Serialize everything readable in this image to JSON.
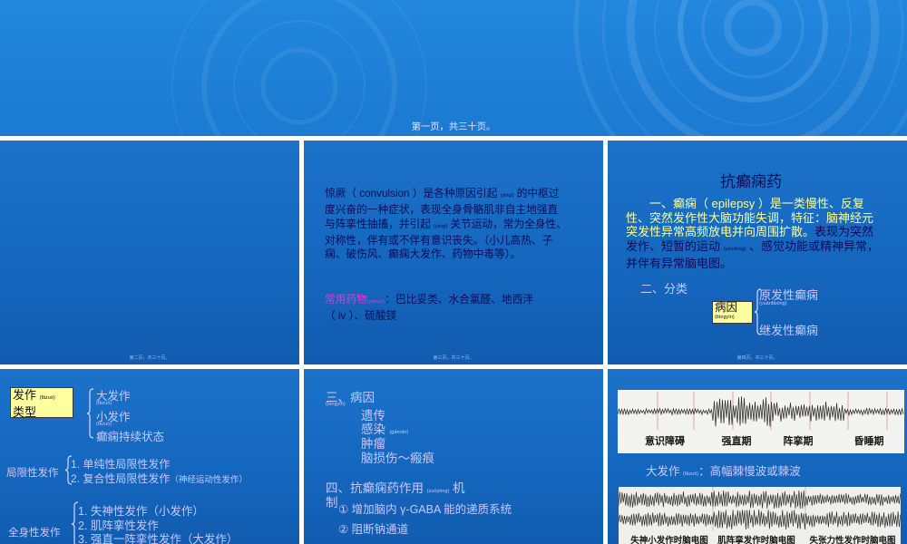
{
  "top_slide": {
    "footer": "第一页，共三十页。"
  },
  "slide_2": {
    "footer": "第二页，共三十页。"
  },
  "slide_3": {
    "lines": [
      [
        "惊厥（ convulsion ）是各种原因引起 ",
        "(yǐnqǐ)",
        " 的中枢过"
      ],
      [
        "度兴奋的一种症状，表现全身骨骼肌非自主地强直"
      ],
      [
        "与阵挛性抽搐，并引起 ",
        "(yǐnqǐ)",
        " 关节运动，常为全身性、"
      ],
      [
        "对称性，伴有或不伴有意识丧失。（小儿高热、子"
      ],
      [
        "痫、破伤风、癫痫大发作、药物中毒等）。"
      ]
    ],
    "drugs_label": "常用药物",
    "drugs_pinyin": "(yàowù)",
    "drugs_text": [
      "：巴比妥类、水合氯醛、地西泮",
      "（ iv ）、硫酸镁"
    ],
    "footer": "第三页，共三十页。"
  },
  "slide_4": {
    "title": "抗癫痫药",
    "lines": [
      [
        "一、癫痫（ epilepsy ）是一类慢性、反复"
      ],
      [
        "性、突然发作性大脑功能失调，特征：脑神经元"
      ],
      [
        "突发性异常高频放电并向周围扩散。",
        "表现为突然"
      ],
      [
        "发作、短暂的运动 ",
        "(yùndòng)",
        " 、感觉功能或精神异常，"
      ],
      [
        "并伴有异常脑电图。"
      ]
    ],
    "section2": "二、分类",
    "cause_box": {
      "label": "病因",
      "pinyin": "(bìngyīn)"
    },
    "types": [
      {
        "label": "原发性癫痫",
        "pinyin": "(yuánfāxìng)"
      },
      {
        "label": "继发性癫痫"
      }
    ],
    "footer": "第四页，共三十页。"
  },
  "slide_5": {
    "type_box": {
      "label1": "发作",
      "pinyin": "(fāzuò)",
      "label2": "类型"
    },
    "types": [
      {
        "label": "大发作",
        "pinyin": "(fāzuò)"
      },
      {
        "label": "小发作",
        "pinyin": "(fāzuò)"
      },
      {
        "label": "癫痫持续状态"
      }
    ],
    "partial": {
      "label": "局限性发作",
      "items": [
        "1. 单纯性局限性发作",
        "2. 复合性局限性发作"
      ],
      "item2_note": "（神经运动性发作）"
    },
    "general": {
      "label": "全身性发作",
      "items": [
        "1. 失神性发作（小发作）",
        "2. 肌阵挛性发作",
        "3. 强直一阵挛性发作（大发作）"
      ]
    }
  },
  "slide_6": {
    "section3": "三、病因",
    "section3_pinyin": "(bìngyīn)",
    "causes": [
      {
        "label": "遗传"
      },
      {
        "label": "感染",
        "pinyin": "(gǎnrǎn)"
      },
      {
        "label": "肿瘤"
      },
      {
        "label": "脑损伤～瘢痕"
      }
    ],
    "section4": [
      "四、抗癫痫药作用 ",
      "(zuòyòng)",
      " 机",
      "制"
    ],
    "mechanisms": [
      "① 增加脑内 γ-GABA 能的递质系统",
      "② 阻断钠通道"
    ]
  },
  "slide_7": {
    "eeg1_labels": [
      "意识障碍",
      "强直期",
      "阵挛期",
      "昏睡期"
    ],
    "caption": [
      "大发作 ",
      "(fāzuò)",
      "：高幅棘慢波或棘波"
    ],
    "eeg2_labels": [
      "失神小发作时脑电图",
      "肌阵挛发作时脑电图",
      "失张力性发作时脑电图"
    ]
  },
  "colors": {
    "slide_bg_top": "#1c72c9",
    "slide_bg": "#1466bd",
    "dark_text": "#0c0c58",
    "yellow_text": "#ffff99",
    "lavender_text": "#c8c8ff",
    "highlight_magenta": "#ff2bd0",
    "label_box": "#ffffa0"
  }
}
